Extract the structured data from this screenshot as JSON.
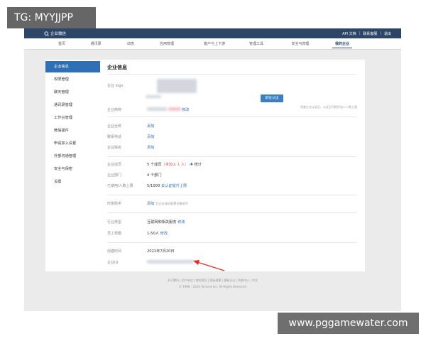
{
  "watermark": {
    "top_left": "TG: MYYJJPP",
    "bottom_right": "www.pggamewater.com"
  },
  "topbar": {
    "brand": "企业微信",
    "links": [
      "API 文档",
      "联系客服",
      "退出"
    ]
  },
  "nav": {
    "items": [
      "首页",
      "通讯录",
      "动态",
      "应用管理",
      "客户与上下游",
      "管理工具",
      "安全与管理",
      "我的企业"
    ],
    "active": "我的企业"
  },
  "sidebar": {
    "items": [
      "企业信息",
      "权限管理",
      "聊天管理",
      "通讯录管理",
      "工作台管理",
      "微信插件",
      "申请加入设置",
      "外部沟通管理",
      "安全与保密",
      "设置"
    ],
    "active": "企业信息"
  },
  "content": {
    "title": "企业信息",
    "logo_label": "企业 logo",
    "name_label": "企业简称",
    "name_edit": "修改",
    "verify_button": "前往认证",
    "verify_hint": "完善企业认证后，认证后可提升加入人数上限",
    "fields": [
      {
        "label": "企业全称",
        "value": "添加"
      },
      {
        "label": "联系电话",
        "value": "添加"
      },
      {
        "label": "企业域名",
        "value": "添加"
      }
    ],
    "members": {
      "label": "企业成员",
      "count": "5 个成员",
      "pending": "（未加入 1 人）",
      "stat_icon": "chart-icon",
      "stat": "统计"
    },
    "depts": {
      "label": "企业部门",
      "value": "4 个部门"
    },
    "limit": {
      "label": "已使用/人数上限",
      "value": "5/1000",
      "action": "去认证提升上限"
    },
    "ad": {
      "label": "形象助手",
      "action": "添加",
      "hint": "为企业成员配置形象助手"
    },
    "industry": {
      "label": "行业类型",
      "value": "互联网和相关服务",
      "edit": "修改"
    },
    "scale": {
      "label": "员工规模",
      "value": "1-50人",
      "edit": "修改"
    },
    "created": {
      "label": "创建时间",
      "value": "2021年7月20日"
    },
    "corpid": {
      "label": "企业ID"
    }
  },
  "footer": {
    "links": "关于腾讯 | 用户协议 | 使用规范 | 隐私政策 | 更新日志 | 帮助中心 | 中文",
    "copyright": "© 1998 - 2024 Tencent Inc. All Rights Reserved"
  },
  "colors": {
    "topbar": "#2d4668",
    "accent": "#2f6fb5",
    "warning": "#d9534f",
    "arrow": "#d9342b"
  }
}
